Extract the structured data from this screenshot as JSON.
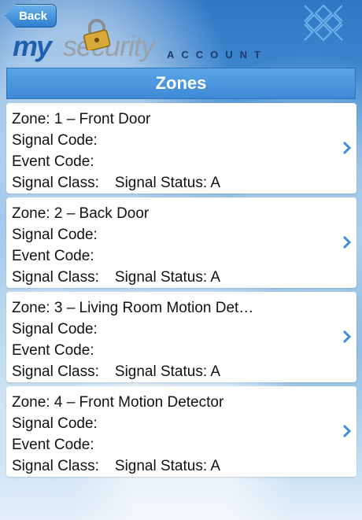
{
  "header": {
    "back_label": "Back",
    "logo_my": "my",
    "logo_security": "security",
    "logo_account": "ACCOUNT"
  },
  "page": {
    "title": "Zones"
  },
  "zones": [
    {
      "zone": "Zone: 1 – Front Door",
      "signal_code": "Signal Code:",
      "event_code": "Event Code:",
      "signal_class": "Signal Class:",
      "signal_status": "Signal Status: A"
    },
    {
      "zone": "Zone: 2 – Back Door",
      "signal_code": "Signal Code:",
      "event_code": "Event Code:",
      "signal_class": "Signal Class:",
      "signal_status": "Signal Status: A"
    },
    {
      "zone": "Zone: 3 – Living Room Motion Det…",
      "signal_code": "Signal Code:",
      "event_code": "Event Code:",
      "signal_class": "Signal Class:",
      "signal_status": "Signal Status: A"
    },
    {
      "zone": "Zone: 4 – Front Motion Detector",
      "signal_code": "Signal Code:",
      "event_code": "Event Code:",
      "signal_class": "Signal Class:",
      "signal_status": "Signal Status: A"
    }
  ],
  "colors": {
    "accent": "#3f8ad6",
    "chevron": "#3b8fd9",
    "logo_blue": "#1f5fae"
  },
  "icons": {
    "back": "back-arrow-button",
    "lock": "padlock-icon",
    "menu": "menu-grid-icon",
    "row": "chevron-right-icon"
  }
}
